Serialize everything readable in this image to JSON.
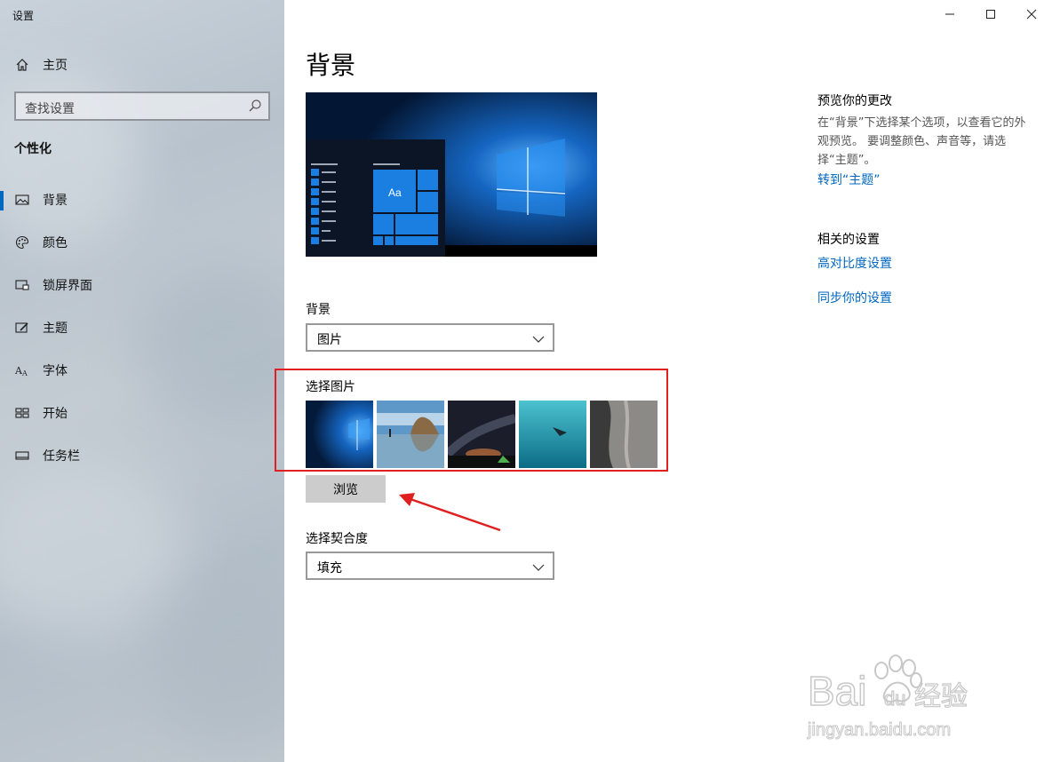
{
  "window": {
    "title": "设置"
  },
  "titlebar": {
    "minimize_icon": "minimize-icon",
    "maximize_icon": "maximize-icon",
    "close_icon": "close-icon"
  },
  "sidebar": {
    "home": {
      "label": "主页",
      "icon": "home-icon"
    },
    "search": {
      "placeholder": "查找设置",
      "icon": "search-icon"
    },
    "section_title": "个性化",
    "items": [
      {
        "label": "背景",
        "icon": "picture-icon",
        "active": true
      },
      {
        "label": "颜色",
        "icon": "palette-icon",
        "active": false
      },
      {
        "label": "锁屏界面",
        "icon": "lock-screen-icon",
        "active": false
      },
      {
        "label": "主题",
        "icon": "theme-brush-icon",
        "active": false
      },
      {
        "label": "字体",
        "icon": "font-icon",
        "active": false
      },
      {
        "label": "开始",
        "icon": "start-icon",
        "active": false
      },
      {
        "label": "任务栏",
        "icon": "taskbar-icon",
        "active": false
      }
    ]
  },
  "main": {
    "page_title": "背景",
    "preview": {
      "tile_text": "Aa"
    },
    "background": {
      "label": "背景",
      "selected": "图片"
    },
    "choose_picture": {
      "label": "选择图片"
    },
    "browse_button": "浏览",
    "fit": {
      "label": "选择契合度",
      "selected": "填充"
    }
  },
  "right": {
    "preview_heading": "预览你的更改",
    "preview_desc": "在“背景”下选择某个选项，以查看它的外观预览。 要调整颜色、声音等，请选择“主题”。",
    "theme_link": "转到“主题”",
    "related_heading": "相关的设置",
    "high_contrast_link": "高对比度设置",
    "sync_link": "同步你的设置"
  },
  "watermark": {
    "brand": "Bai",
    "brand2": "du",
    "cn": "经验",
    "url": "jingyan.baidu.com"
  },
  "colors": {
    "accent": "#0067c0",
    "highlight": "#e02020",
    "sidebar_bg": "#c2cad1"
  }
}
